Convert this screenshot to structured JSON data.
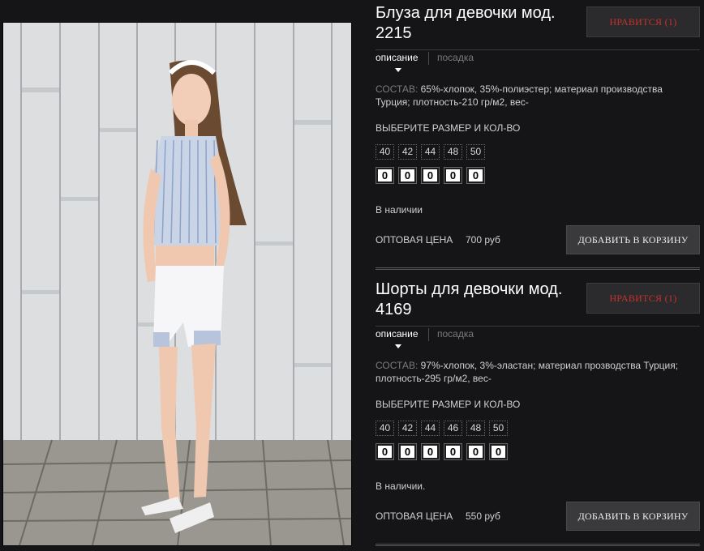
{
  "colors": {
    "background": "#151517",
    "like": "#c8322c",
    "button": "#3a3a3c"
  },
  "products": [
    {
      "title": "Блуза для девочки мод. 2215",
      "like_label": "НРАВИТСЯ (1)",
      "tabs": [
        "описание",
        "посадка"
      ],
      "composition_label": "СОСТАВ:",
      "composition_text": "65%-хлопок, 35%-полиэстер; материал производства Турция; плотность-210 гр/м2, вес-",
      "size_title": "ВЫБЕРИТЕ РАЗМЕР И КОЛ-ВО",
      "sizes": [
        "40",
        "42",
        "44",
        "48",
        "50"
      ],
      "quantities": [
        "0",
        "0",
        "0",
        "0",
        "0"
      ],
      "stock": "В наличии",
      "price_label": "ОПТОВАЯ ЦЕНА",
      "price": "700 руб",
      "cart_label": "ДОБАВИТЬ В КОРЗИНУ"
    },
    {
      "title": "Шорты для девочки мод. 4169",
      "like_label": "НРАВИТСЯ (1)",
      "tabs": [
        "описание",
        "посадка"
      ],
      "composition_label": "СОСТАВ:",
      "composition_text": "97%-хлопок, 3%-эластан; материал прозводства Турция; плотность-295 гр/м2, вес-",
      "size_title": "ВЫБЕРИТЕ РАЗМЕР И КОЛ-ВО",
      "sizes": [
        "40",
        "42",
        "44",
        "46",
        "48",
        "50"
      ],
      "quantities": [
        "0",
        "0",
        "0",
        "0",
        "0",
        "0"
      ],
      "stock": "В наличии.",
      "price_label": "ОПТОВАЯ ЦЕНА",
      "price": "550 руб",
      "cart_label": "ДОБАВИТЬ В КОРЗИНУ"
    }
  ]
}
